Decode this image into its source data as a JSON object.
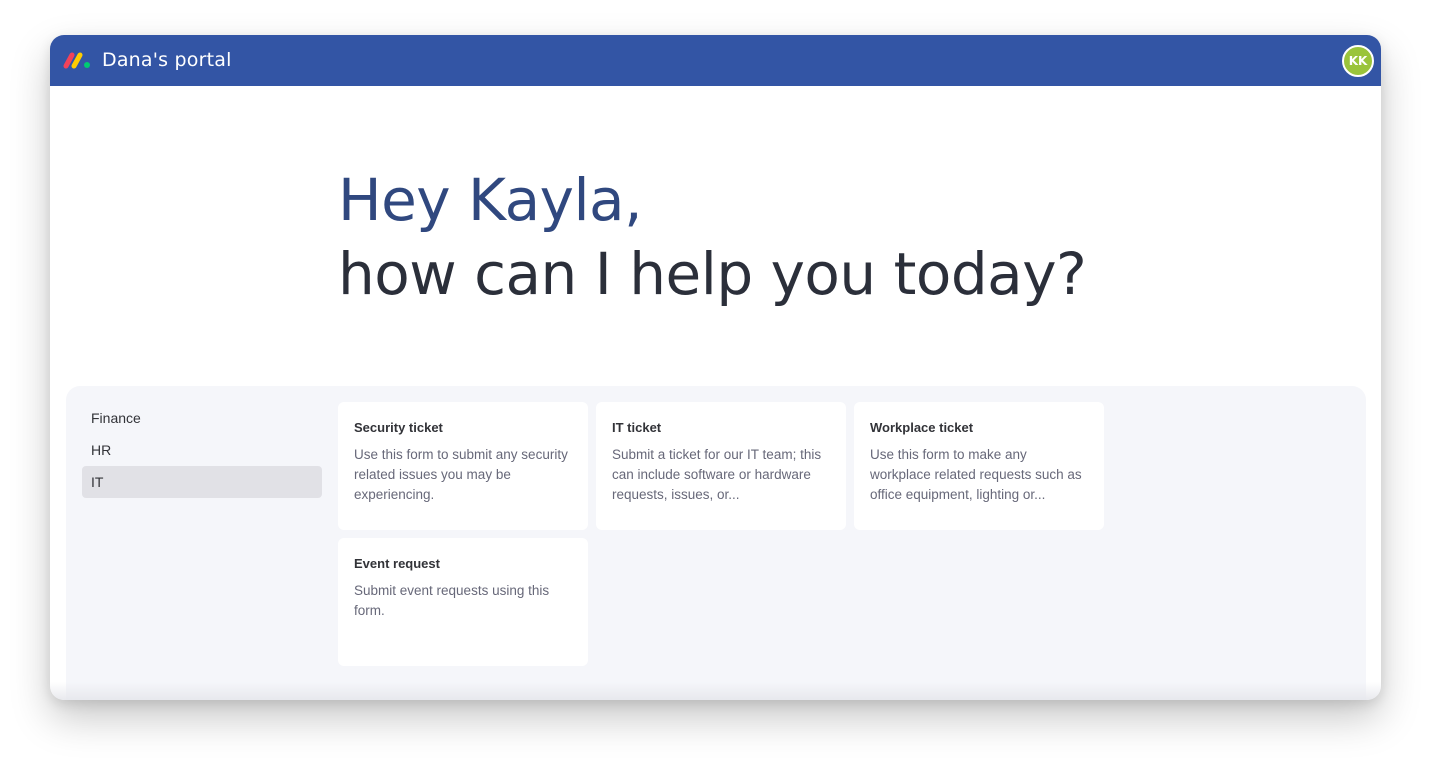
{
  "header": {
    "portal_title": "Dana's portal",
    "avatar_initials": "KK",
    "logo_icon": "monday-logo-icon",
    "colors": {
      "bar": "#3355a5",
      "avatar": "#9ac43b"
    }
  },
  "hero": {
    "greeting": "Hey Kayla,",
    "question": "how can I help you today?"
  },
  "sidebar": {
    "items": [
      {
        "label": "Finance",
        "active": false
      },
      {
        "label": "HR",
        "active": false
      },
      {
        "label": "IT",
        "active": true
      }
    ]
  },
  "cards": [
    {
      "title": "Security ticket",
      "description": "Use this form to submit any security related issues you may be experiencing."
    },
    {
      "title": "IT ticket",
      "description": "Submit a ticket for our IT team; this can include software or hardware requests, issues, or..."
    },
    {
      "title": "Workplace ticket",
      "description": "Use this form to make any workplace related requests such as office equipment, lighting or..."
    },
    {
      "title": "Event request",
      "description": "Submit event requests using this form."
    }
  ]
}
